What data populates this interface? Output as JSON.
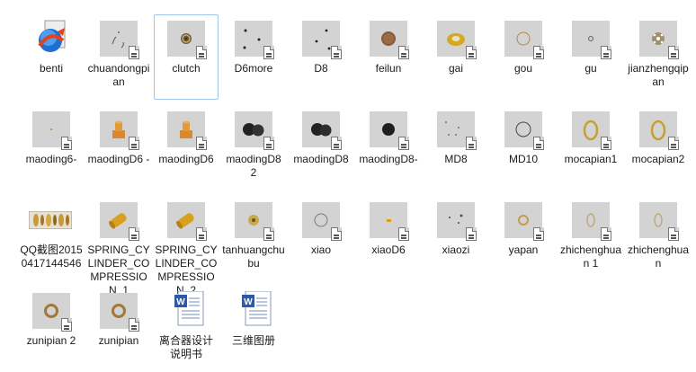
{
  "selected": "clutch",
  "files": [
    {
      "name": "benti",
      "icon": "app-icon",
      "kind": "app"
    },
    {
      "name": "chuandongpian",
      "icon": "part-thumbnail-icon",
      "kind": "part"
    },
    {
      "name": "clutch",
      "icon": "part-thumbnail-icon",
      "kind": "part"
    },
    {
      "name": "D6more",
      "icon": "part-thumbnail-icon",
      "kind": "part"
    },
    {
      "name": "D8",
      "icon": "part-thumbnail-icon",
      "kind": "part"
    },
    {
      "name": "feilun",
      "icon": "part-thumbnail-icon",
      "kind": "part"
    },
    {
      "name": "gai",
      "icon": "part-thumbnail-icon",
      "kind": "part"
    },
    {
      "name": "gou",
      "icon": "part-thumbnail-icon",
      "kind": "part"
    },
    {
      "name": "gu",
      "icon": "part-thumbnail-icon",
      "kind": "part"
    },
    {
      "name": "jianzhengqipan",
      "icon": "part-thumbnail-icon",
      "kind": "part"
    },
    {
      "name": "maoding6-",
      "icon": "part-thumbnail-icon",
      "kind": "part"
    },
    {
      "name": "maodingD6 -",
      "icon": "part-thumbnail-icon",
      "kind": "part"
    },
    {
      "name": "maodingD6",
      "icon": "part-thumbnail-icon",
      "kind": "part"
    },
    {
      "name": "maodingD8 2",
      "icon": "part-thumbnail-icon",
      "kind": "part"
    },
    {
      "name": "maodingD8",
      "icon": "part-thumbnail-icon",
      "kind": "part"
    },
    {
      "name": "maodingD8-",
      "icon": "part-thumbnail-icon",
      "kind": "part"
    },
    {
      "name": "MD8",
      "icon": "part-thumbnail-icon",
      "kind": "part"
    },
    {
      "name": "MD10",
      "icon": "part-thumbnail-icon",
      "kind": "part"
    },
    {
      "name": "mocapian1",
      "icon": "part-thumbnail-icon",
      "kind": "part"
    },
    {
      "name": "mocapian2",
      "icon": "part-thumbnail-icon",
      "kind": "part"
    },
    {
      "name": "QQ截图20150417144546",
      "icon": "image-thumbnail-icon",
      "kind": "image"
    },
    {
      "name": "SPRING_CYLINDER_COMPRESSION_1",
      "icon": "part-thumbnail-icon",
      "kind": "part"
    },
    {
      "name": "SPRING_CYLINDER_COMPRESSION_2",
      "icon": "part-thumbnail-icon",
      "kind": "part"
    },
    {
      "name": "tanhuangchubu",
      "icon": "part-thumbnail-icon",
      "kind": "part"
    },
    {
      "name": "xiao",
      "icon": "part-thumbnail-icon",
      "kind": "part"
    },
    {
      "name": "xiaoD6",
      "icon": "part-thumbnail-icon",
      "kind": "part"
    },
    {
      "name": "xiaozi",
      "icon": "part-thumbnail-icon",
      "kind": "part"
    },
    {
      "name": "yapan",
      "icon": "part-thumbnail-icon",
      "kind": "part"
    },
    {
      "name": "zhichenghuan 1",
      "icon": "part-thumbnail-icon",
      "kind": "part"
    },
    {
      "name": "zhichenghuan",
      "icon": "part-thumbnail-icon",
      "kind": "part"
    },
    {
      "name": "zunipian 2",
      "icon": "part-thumbnail-icon",
      "kind": "part"
    },
    {
      "name": "zunipian",
      "icon": "part-thumbnail-icon",
      "kind": "part"
    },
    {
      "name": "离合器设计说明书",
      "icon": "word-document-icon",
      "kind": "doc"
    },
    {
      "name": "三维图册",
      "icon": "word-document-icon",
      "kind": "doc"
    }
  ],
  "colors": {
    "selection_border": "#9ec7ea",
    "thumbnail_bg": "#d3d3d3",
    "text": "#1b1b1b"
  }
}
